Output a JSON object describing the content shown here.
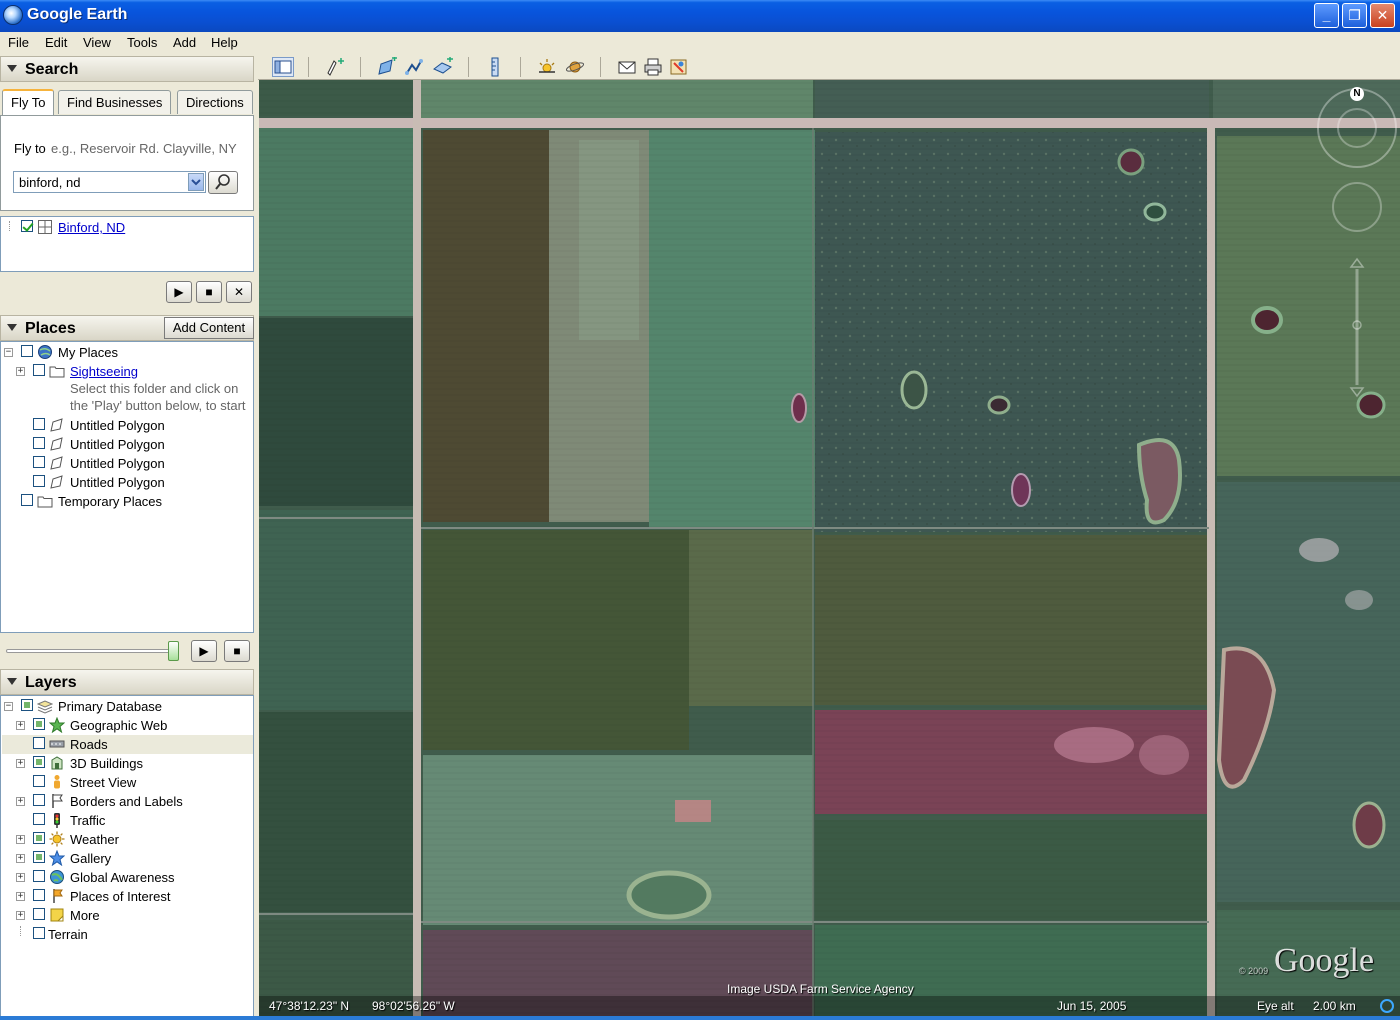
{
  "window": {
    "title": "Google Earth"
  },
  "menu": [
    "File",
    "Edit",
    "View",
    "Tools",
    "Add",
    "Help"
  ],
  "search": {
    "header": "Search",
    "tabs": [
      "Fly To",
      "Find Businesses",
      "Directions"
    ],
    "fly_to_label": "Fly to",
    "fly_to_hint": "e.g., Reservoir Rd. Clayville, NY",
    "input_value": "binford, nd",
    "result": "Binford, ND"
  },
  "places": {
    "header": "Places",
    "add_content": "Add Content",
    "my_places": "My Places",
    "sightseeing": "Sightseeing",
    "sightseeing_note_1": "Select this folder and click on",
    "sightseeing_note_2": "the 'Play' button below, to start",
    "polygons": [
      "Untitled Polygon",
      "Untitled Polygon",
      "Untitled Polygon",
      "Untitled Polygon"
    ],
    "temporary": "Temporary Places"
  },
  "layers": {
    "header": "Layers",
    "root": "Primary Database",
    "items": [
      {
        "label": "Geographic Web"
      },
      {
        "label": "Roads"
      },
      {
        "label": "3D Buildings"
      },
      {
        "label": "Street View"
      },
      {
        "label": "Borders and Labels"
      },
      {
        "label": "Traffic"
      },
      {
        "label": "Weather"
      },
      {
        "label": "Gallery"
      },
      {
        "label": "Global Awareness"
      },
      {
        "label": "Places of Interest"
      },
      {
        "label": "More"
      }
    ],
    "terrain": "Terrain"
  },
  "map": {
    "attribution": "Image USDA Farm Service Agency",
    "latitude": "47°38'12.23\" N",
    "longitude": "98°02'56.26\" W",
    "date": "Jun 15, 2005",
    "eye_alt_label": "Eye alt",
    "eye_alt_value": "2.00 km",
    "compass_north": "N",
    "logo": "Google",
    "copyright": "© 2009"
  }
}
